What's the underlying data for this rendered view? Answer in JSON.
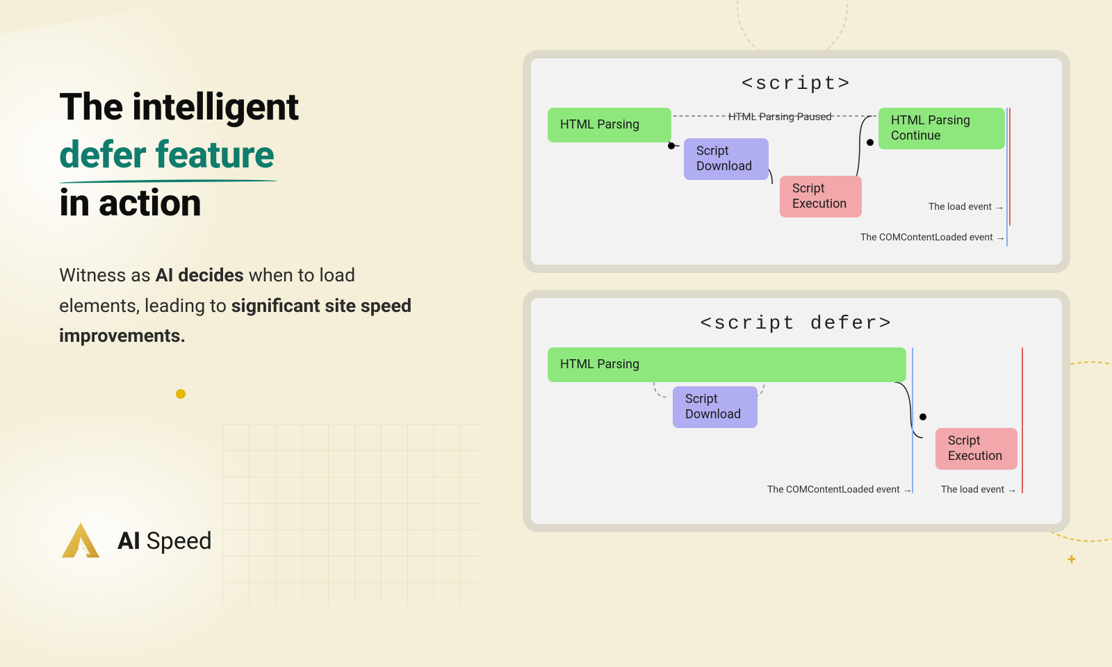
{
  "headline": {
    "line1": "The intelligent",
    "accent": "defer feature",
    "line3": "in action"
  },
  "subtitle": {
    "pre": "Witness as ",
    "bold1": "AI decides",
    "mid": " when to load elements, leading to ",
    "bold2": "significant site speed improvements."
  },
  "brand": {
    "bold": "AI",
    "rest": " Speed"
  },
  "diagram1": {
    "title": "<script>",
    "blocks": {
      "htmlParsing": "HTML Parsing",
      "scriptDownload": "Script Download",
      "scriptExecution": "Script Execution",
      "htmlParsingContinue": "HTML Parsing Continue"
    },
    "pausedLabel": "HTML Parsing Paused",
    "events": {
      "load": "The load event",
      "domContentLoaded": "The COMContentLoaded event"
    }
  },
  "diagram2": {
    "title": "<script defer>",
    "blocks": {
      "htmlParsing": "HTML Parsing",
      "scriptDownload": "Script Download",
      "scriptExecution": "Script Execution"
    },
    "events": {
      "load": "The load event",
      "domContentLoaded": "The COMContentLoaded event"
    }
  }
}
